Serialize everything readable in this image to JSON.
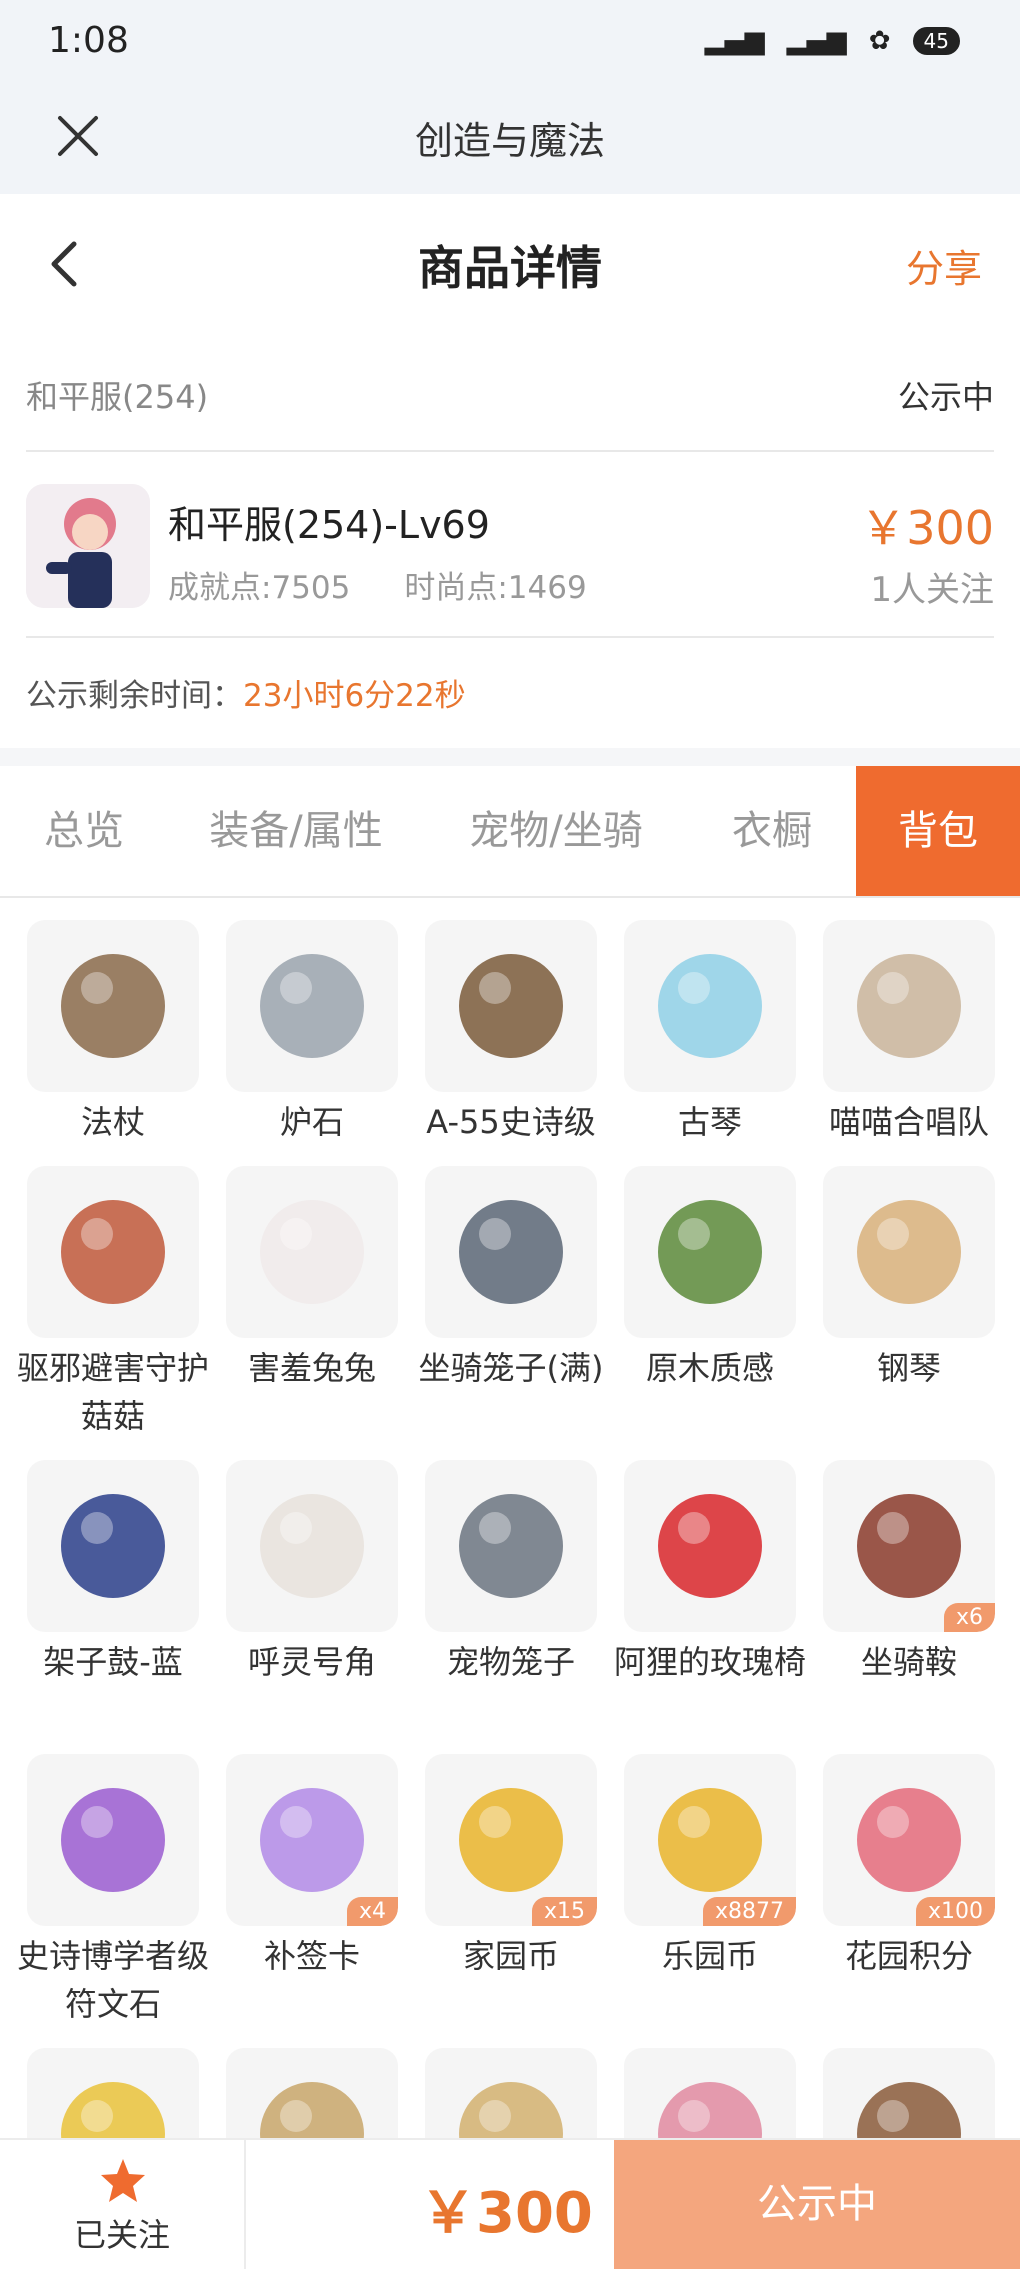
{
  "status_bar": {
    "time": "1:08",
    "battery": "45"
  },
  "app_bar": {
    "title": "创造与魔法"
  },
  "nav": {
    "title": "商品详情",
    "share": "分享"
  },
  "server": {
    "name": "和平服(254)",
    "status": "公示中"
  },
  "character": {
    "name": "和平服(254)-Lv69",
    "achievement": "成就点:7505",
    "fashion": "时尚点:1469",
    "price": "￥300",
    "followers": "1人关注"
  },
  "timer": {
    "label": "公示剩余时间：",
    "value": "23小时6分22秒"
  },
  "tabs": [
    "总览",
    "装备/属性",
    "宠物/坐骑",
    "衣橱",
    "背包"
  ],
  "active_tab": "背包",
  "items": [
    {
      "label": "法杖",
      "icon": "staff-icon",
      "count": ""
    },
    {
      "label": "炉石",
      "icon": "hearthstone-icon",
      "count": ""
    },
    {
      "label": "A-55史诗级",
      "icon": "rifle-icon",
      "count": ""
    },
    {
      "label": "古琴",
      "icon": "guqin-icon",
      "count": ""
    },
    {
      "label": "喵喵合唱队",
      "icon": "cat-choir-icon",
      "count": ""
    },
    {
      "label": "驱邪避害守护菇菇",
      "icon": "mushroom-icon",
      "count": ""
    },
    {
      "label": "害羞兔兔",
      "icon": "rabbit-icon",
      "count": ""
    },
    {
      "label": "坐骑笼子(满)",
      "icon": "mount-cage-icon",
      "count": ""
    },
    {
      "label": "原木质感",
      "icon": "wood-block-icon",
      "count": ""
    },
    {
      "label": "钢琴",
      "icon": "piano-icon",
      "count": ""
    },
    {
      "label": "架子鼓-蓝",
      "icon": "drum-kit-icon",
      "count": ""
    },
    {
      "label": "呼灵号角",
      "icon": "horn-icon",
      "count": ""
    },
    {
      "label": "宠物笼子",
      "icon": "pet-cage-icon",
      "count": ""
    },
    {
      "label": "阿狸的玫瑰椅",
      "icon": "rose-icon",
      "count": ""
    },
    {
      "label": "坐骑鞍",
      "icon": "saddle-icon",
      "count": "x6"
    },
    {
      "label": "史诗博学者级符文石",
      "icon": "rune-stone-icon",
      "count": ""
    },
    {
      "label": "补签卡",
      "icon": "sign-card-icon",
      "count": "x4"
    },
    {
      "label": "家园币",
      "icon": "home-coin-icon",
      "count": "x15"
    },
    {
      "label": "乐园币",
      "icon": "park-coin-icon",
      "count": "x8877"
    },
    {
      "label": "花园积分",
      "icon": "garden-points-icon",
      "count": "x100"
    },
    {
      "label": "",
      "icon": "gold-item-icon",
      "count": ""
    },
    {
      "label": "",
      "icon": "wanted-poster-icon",
      "count": ""
    },
    {
      "label": "",
      "icon": "scroll-icon",
      "count": ""
    },
    {
      "label": "",
      "icon": "ring-icon",
      "count": ""
    },
    {
      "label": "",
      "icon": "wood-club-icon",
      "count": ""
    }
  ],
  "bottom": {
    "follow_label": "已关注",
    "price": "￥300",
    "action": "公示中"
  },
  "colors": {
    "accent": "#ef6b2f",
    "price": "#e8762f",
    "action_bg": "#f4a67e"
  }
}
